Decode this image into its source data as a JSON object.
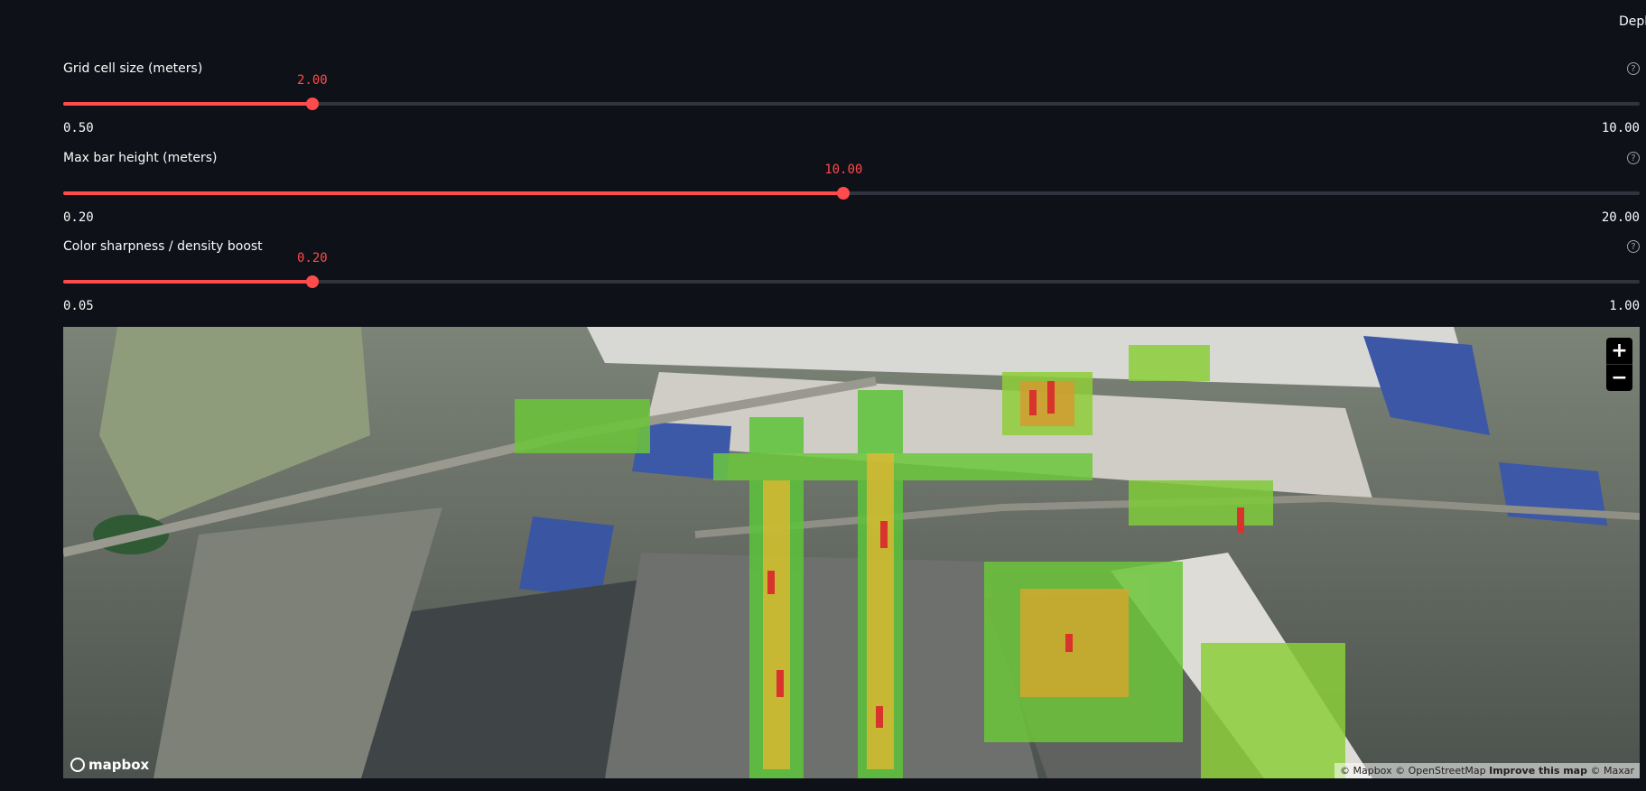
{
  "header": {
    "deploy_label": "Deploy"
  },
  "sliders": [
    {
      "label": "Grid cell size (meters)",
      "value": "2.00",
      "min": "0.50",
      "max": "10.00",
      "fraction": 0.158
    },
    {
      "label": "Max bar height (meters)",
      "value": "10.00",
      "min": "0.20",
      "max": "20.00",
      "fraction": 0.495
    },
    {
      "label": "Color sharpness / density boost",
      "value": "0.20",
      "min": "0.05",
      "max": "1.00",
      "fraction": 0.158
    }
  ],
  "help_icon_glyph": "?",
  "map": {
    "zoom_in": "+",
    "zoom_out": "−",
    "logo_text": "mapbox",
    "attribution": {
      "mapbox": "© Mapbox",
      "osm": "© OpenStreetMap",
      "improve": "Improve this map",
      "maxar": "© Maxar"
    }
  },
  "colors": {
    "accent": "#ff4b4b",
    "background": "#0e1117",
    "track": "#31333f"
  }
}
